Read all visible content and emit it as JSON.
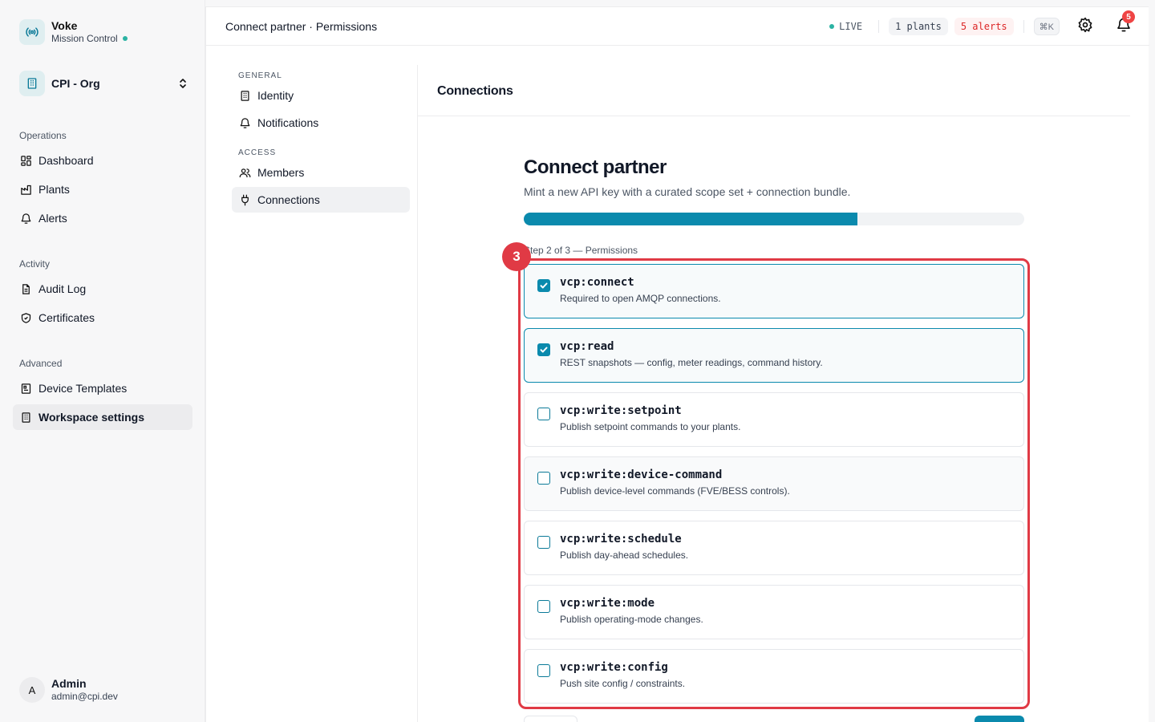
{
  "brand": {
    "name": "Voke",
    "subtitle": "Mission Control"
  },
  "org": {
    "name": "CPI - Org"
  },
  "sidebar": {
    "sections": [
      {
        "label": "Operations",
        "items": [
          {
            "label": "Dashboard",
            "icon": "dashboard-icon"
          },
          {
            "label": "Plants",
            "icon": "factory-icon"
          },
          {
            "label": "Alerts",
            "icon": "bell-icon"
          }
        ]
      },
      {
        "label": "Activity",
        "items": [
          {
            "label": "Audit Log",
            "icon": "document-icon"
          },
          {
            "label": "Certificates",
            "icon": "shield-icon"
          }
        ]
      },
      {
        "label": "Advanced",
        "items": [
          {
            "label": "Device Templates",
            "icon": "template-icon"
          },
          {
            "label": "Workspace settings",
            "icon": "building-icon",
            "active": true
          }
        ]
      }
    ]
  },
  "user": {
    "initial": "A",
    "name": "Admin",
    "email": "admin@cpi.dev"
  },
  "topbar": {
    "breadcrumb": "Connect partner · Permissions",
    "live_label": "LIVE",
    "plants_label": "1 plants",
    "alerts_label": "5 alerts",
    "shortcut_label": "⌘K",
    "notification_count": "5"
  },
  "subnav": {
    "general_label": "GENERAL",
    "access_label": "ACCESS",
    "identity": "Identity",
    "notifications": "Notifications",
    "members": "Members",
    "connections": "Connections"
  },
  "content": {
    "title": "Connections"
  },
  "form": {
    "title": "Connect partner",
    "subtitle": "Mint a new API key with a curated scope set + connection bundle.",
    "progress_percent": 66.7,
    "step_label": "Step 2 of 3 — Permissions",
    "scopes": [
      {
        "name": "vcp:connect",
        "desc": "Required to open AMQP connections.",
        "checked": true
      },
      {
        "name": "vcp:read",
        "desc": "REST snapshots — config, meter readings, command history.",
        "checked": true
      },
      {
        "name": "vcp:write:setpoint",
        "desc": "Publish setpoint commands to your plants.",
        "checked": false
      },
      {
        "name": "vcp:write:device-command",
        "desc": "Publish device-level commands (FVE/BESS controls).",
        "checked": false
      },
      {
        "name": "vcp:write:schedule",
        "desc": "Publish day-ahead schedules.",
        "checked": false
      },
      {
        "name": "vcp:write:mode",
        "desc": "Publish operating-mode changes.",
        "checked": false
      },
      {
        "name": "vcp:write:config",
        "desc": "Push site config / constraints.",
        "checked": false
      }
    ]
  },
  "annotation": {
    "marker_label": "3"
  },
  "colors": {
    "accent": "#0b8aad",
    "highlight": "#e03a45",
    "alert": "#dc2626"
  }
}
